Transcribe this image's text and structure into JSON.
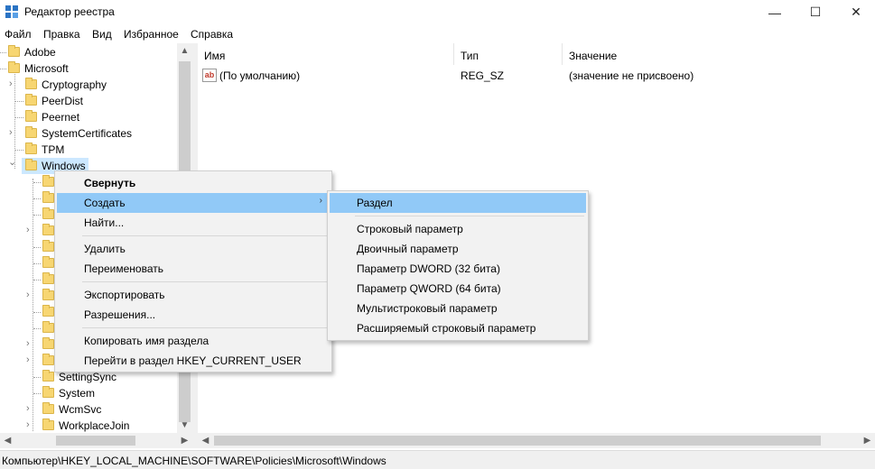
{
  "window": {
    "title": "Редактор реестра",
    "minimize_glyph": "—",
    "maximize_glyph": "☐",
    "close_glyph": "✕"
  },
  "menubar": {
    "items": [
      "Файл",
      "Правка",
      "Вид",
      "Избранное",
      "Справка"
    ]
  },
  "tree": {
    "items": [
      {
        "label": "Adobe"
      },
      {
        "label": "Microsoft"
      },
      {
        "label": "Cryptography"
      },
      {
        "label": "PeerDist"
      },
      {
        "label": "Peernet"
      },
      {
        "label": "SystemCertificates"
      },
      {
        "label": "TPM"
      },
      {
        "label": "Windows"
      },
      {
        "label": "SettingSync"
      },
      {
        "label": "System"
      },
      {
        "label": "WcmSvc"
      },
      {
        "label": "WorkplaceJoin"
      }
    ],
    "chevron_right": "›",
    "chevron_down": "⌄"
  },
  "list": {
    "columns": [
      "Имя",
      "Тип",
      "Значение"
    ],
    "rows": [
      {
        "icon": "ab",
        "name": "(По умолчанию)",
        "type": "REG_SZ",
        "value": "(значение не присвоено)"
      }
    ]
  },
  "context_menu": {
    "items": [
      {
        "label": "Свернуть",
        "bold": true
      },
      {
        "label": "Создать",
        "submenu": true
      },
      {
        "label": "Найти..."
      },
      {
        "label": "Удалить"
      },
      {
        "label": "Переименовать"
      },
      {
        "label": "Экспортировать"
      },
      {
        "label": "Разрешения..."
      },
      {
        "label": "Копировать имя раздела"
      },
      {
        "label": "Перейти в раздел HKEY_CURRENT_USER"
      }
    ],
    "submenu_arrow": "›"
  },
  "submenu": {
    "items": [
      {
        "label": "Раздел"
      },
      {
        "label": "Строковый параметр"
      },
      {
        "label": "Двоичный параметр"
      },
      {
        "label": "Параметр DWORD (32 бита)"
      },
      {
        "label": "Параметр QWORD (64 бита)"
      },
      {
        "label": "Мультистроковый параметр"
      },
      {
        "label": "Расширяемый строковый параметр"
      }
    ]
  },
  "statusbar": {
    "path": "Компьютер\\HKEY_LOCAL_MACHINE\\SOFTWARE\\Policies\\Microsoft\\Windows"
  },
  "colors": {
    "highlight": "#91c9f7",
    "selection": "#cce8ff",
    "folder": "#f7d672"
  }
}
